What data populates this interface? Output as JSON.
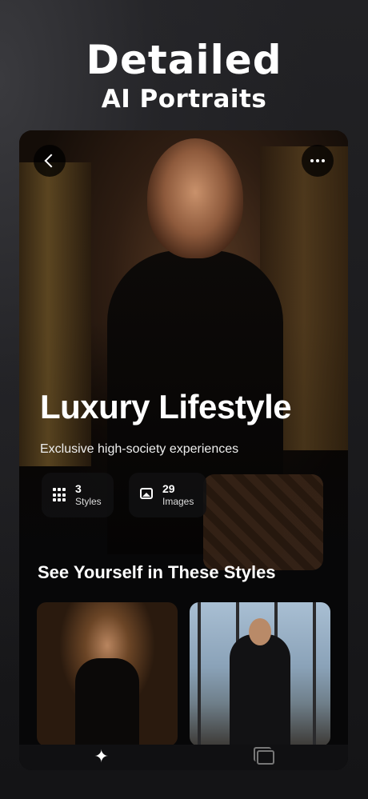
{
  "promo": {
    "headline_line1": "Detailed",
    "headline_line2": "AI Portraits"
  },
  "hero": {
    "title": "Luxury Lifestyle",
    "subtitle": "Exclusive high-society experiences",
    "back_icon": "chevron-left-icon",
    "more_icon": "more-horizontal-icon"
  },
  "stats": [
    {
      "value": "3",
      "label": "Styles",
      "icon": "grid-icon"
    },
    {
      "value": "29",
      "label": "Images",
      "icon": "image-icon"
    }
  ],
  "section": {
    "title": "See Yourself in These Styles"
  },
  "gallery": [
    {
      "name": "portrait-woman-boutique"
    },
    {
      "name": "portrait-man-skyline"
    }
  ],
  "tabbar": {
    "items": [
      {
        "icon": "sparkles-icon",
        "active": true
      },
      {
        "icon": "gallery-icon",
        "active": false
      }
    ]
  },
  "colors": {
    "background": "#1a1a1c",
    "card_bg": "#070708",
    "accent_gold": "#6b5226"
  }
}
